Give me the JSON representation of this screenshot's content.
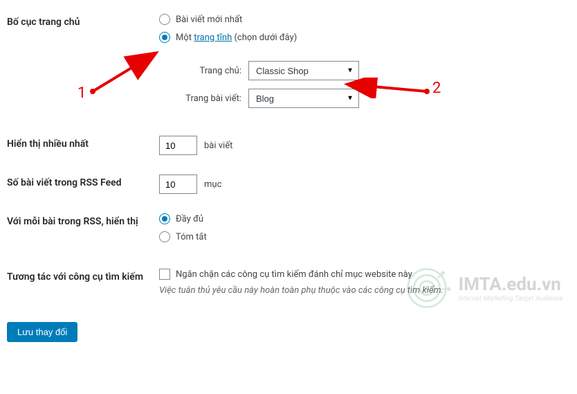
{
  "layout": {
    "label": "Bố cục trang chủ",
    "radio_latest": "Bài viết mới nhất",
    "radio_static_prefix": "Một ",
    "radio_static_link": "trang tĩnh",
    "radio_static_suffix": " (chọn dưới đây)",
    "homepage_label": "Trang chủ:",
    "homepage_value": "Classic Shop",
    "posts_page_label": "Trang bài viết:",
    "posts_page_value": "Blog"
  },
  "max_display": {
    "label": "Hiển thị nhiều nhất",
    "value": "10",
    "suffix": "bài viết"
  },
  "rss_count": {
    "label": "Số bài viết trong RSS Feed",
    "value": "10",
    "suffix": "mục"
  },
  "rss_display": {
    "label": "Với mỗi bài trong RSS, hiển thị",
    "full": "Đầy đủ",
    "summary": "Tóm tắt"
  },
  "search_engine": {
    "label": "Tương tác với công cụ tìm kiếm",
    "checkbox_label": "Ngăn chặn các công cụ tìm kiếm đánh chỉ mục website này",
    "description": "Việc tuân thủ yêu cầu này hoàn toàn phụ thuộc vào các công cụ tìm kiếm."
  },
  "submit": {
    "label": "Lưu thay đổi"
  },
  "annotations": {
    "one": "1",
    "two": "2"
  },
  "watermark": {
    "title": "IMTA.edu.vn",
    "subtitle": "Internet Marketing Target Audience"
  }
}
